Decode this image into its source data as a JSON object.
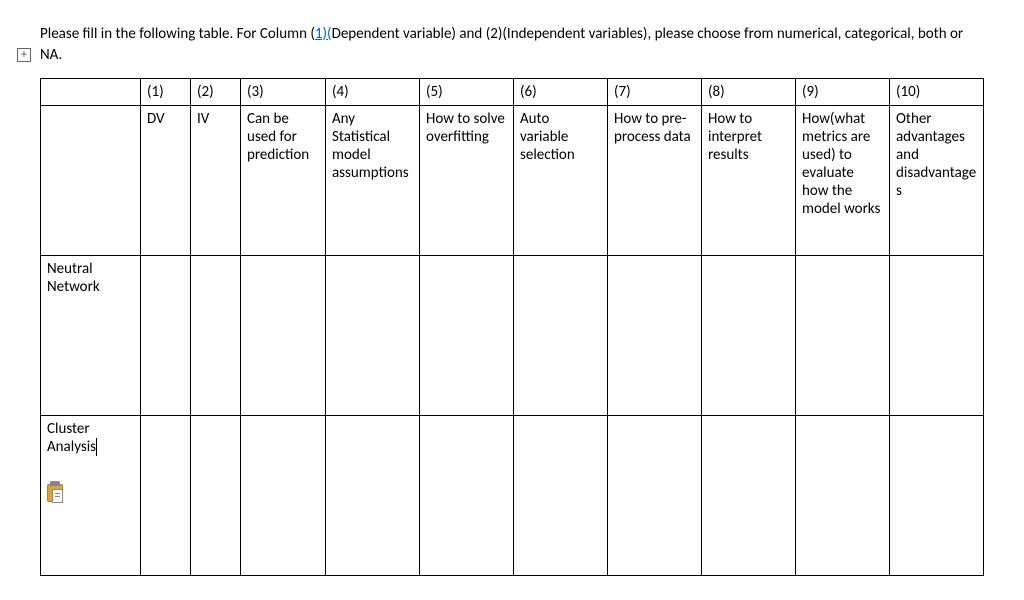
{
  "instruction": {
    "prefix": "Please fill in the following table. For Column (",
    "link": "1)(",
    "mid": "Dependent variable) and (2)(Independent variables), please choose from numerical, categorical, both or NA."
  },
  "outline_symbol": "+",
  "columns": {
    "nums": [
      "(1)",
      "(2)",
      "(3)",
      "(4)",
      "(5)",
      "(6)",
      "(7)",
      "(8)",
      "(9)",
      "(10)"
    ],
    "labels": [
      "DV",
      "IV",
      "Can be used for prediction",
      "Any Statistical model assumptions",
      "How to solve overfitting",
      "Auto variable selection",
      "How to pre-process data",
      "How to interpret results",
      "How(what metrics are used) to evaluate how the model works",
      "Other advantages and disadvantages"
    ]
  },
  "rows": [
    {
      "method": "Neutral Network",
      "cells": [
        "",
        "",
        "",
        "",
        "",
        "",
        "",
        "",
        "",
        ""
      ]
    },
    {
      "method": "Cluster Analysis",
      "cells": [
        "",
        "",
        "",
        "",
        "",
        "",
        "",
        "",
        "",
        ""
      ],
      "has_paste_icon": true
    }
  ]
}
